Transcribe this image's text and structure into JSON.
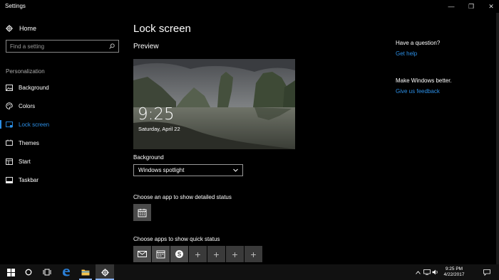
{
  "window": {
    "title": "Settings",
    "controls": {
      "minimize": "—",
      "maximize": "❐",
      "close": "✕"
    }
  },
  "sidebar": {
    "home_label": "Home",
    "search_placeholder": "Find a setting",
    "section_label": "Personalization",
    "items": [
      {
        "label": "Background",
        "icon": "picture-icon",
        "active": false
      },
      {
        "label": "Colors",
        "icon": "palette-icon",
        "active": false
      },
      {
        "label": "Lock screen",
        "icon": "lock-screen-icon",
        "active": true
      },
      {
        "label": "Themes",
        "icon": "brush-icon",
        "active": false
      },
      {
        "label": "Start",
        "icon": "start-icon",
        "active": false
      },
      {
        "label": "Taskbar",
        "icon": "taskbar-icon",
        "active": false
      }
    ]
  },
  "main": {
    "title": "Lock screen",
    "preview_label": "Preview",
    "preview_time": "9:25",
    "preview_date": "Saturday, April 22",
    "background_label": "Background",
    "background_value": "Windows spotlight",
    "detailed_status_label": "Choose an app to show detailed status",
    "quick_status_label": "Choose apps to show quick status",
    "quick_status_apps": [
      "mail-icon",
      "calendar-icon",
      "skype-icon",
      "add-icon",
      "add-icon",
      "add-icon",
      "add-icon"
    ],
    "add_symbol": "+"
  },
  "help": {
    "question_heading": "Have a question?",
    "question_link": "Get help",
    "feedback_heading": "Make Windows better.",
    "feedback_link": "Give us feedback"
  },
  "taskbar": {
    "time": "9:25 PM",
    "date": "4/22/2017"
  },
  "colors": {
    "accent": "#2c8fe6",
    "background": "#000000",
    "tile": "#4a4a4a"
  }
}
